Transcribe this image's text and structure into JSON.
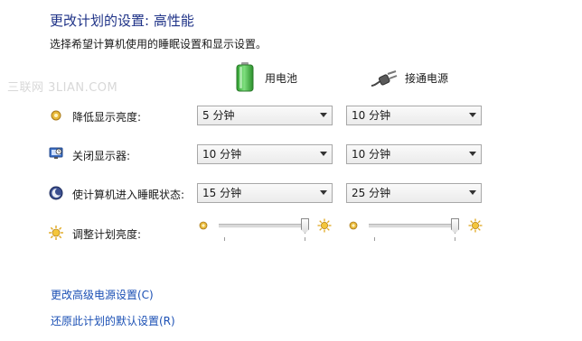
{
  "header": {
    "title": "更改计划的设置: 高性能",
    "subtitle": "选择希望计算机使用的睡眠设置和显示设置。"
  },
  "watermark": "三联网 3LIAN.COM",
  "columns": {
    "battery_label": "用电池",
    "plugged_label": "接通电源"
  },
  "settings": {
    "dim_display": {
      "label": "降低显示亮度:",
      "battery": "5 分钟",
      "plugged": "10 分钟"
    },
    "turn_off_display": {
      "label": "关闭显示器:",
      "battery": "10 分钟",
      "plugged": "10 分钟"
    },
    "sleep": {
      "label": "使计算机进入睡眠状态:",
      "battery": "15 分钟",
      "plugged": "25 分钟"
    },
    "brightness": {
      "label": "调整计划亮度:",
      "battery_level": 1.0,
      "plugged_level": 1.0
    }
  },
  "links": {
    "advanced": "更改高级电源设置(C)",
    "restore": "还原此计划的默认设置(R)"
  },
  "colors": {
    "title": "#1e3287",
    "link": "#1a4fb4",
    "battery_green": "#3cb83c"
  },
  "icons": [
    "battery-icon",
    "power-plug-icon",
    "dim-brightness-icon",
    "monitor-icon",
    "sleep-moon-icon",
    "brightness-sun-icon"
  ]
}
